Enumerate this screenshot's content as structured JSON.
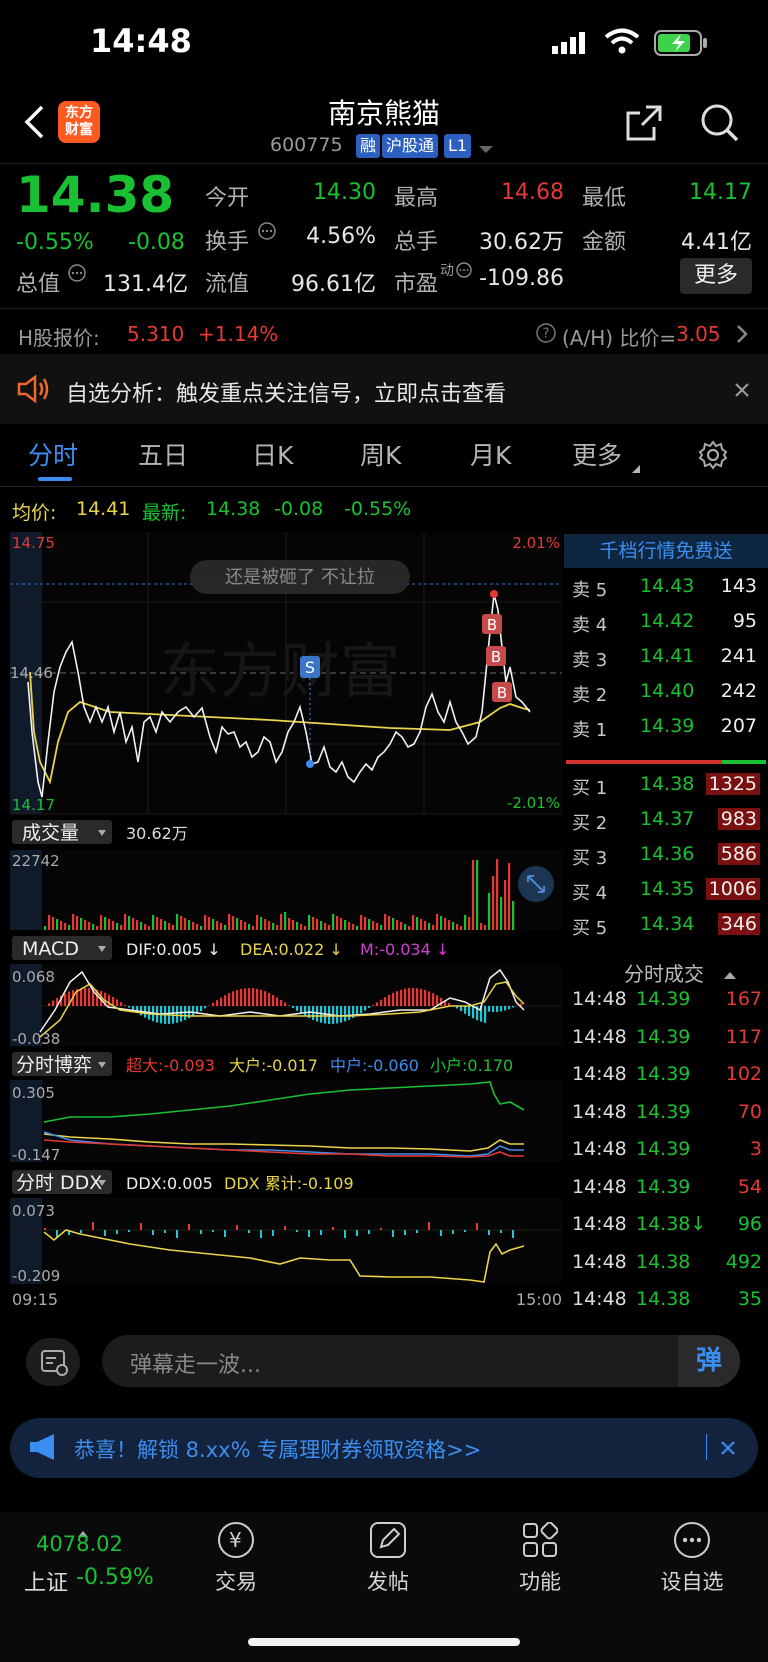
{
  "status_bar": {
    "time": "14:48"
  },
  "header": {
    "logo_text": "东方\n财富",
    "stock_name": "南京熊猫",
    "stock_code": "600775",
    "tags": [
      "融",
      "沪股通",
      "L1"
    ]
  },
  "quote": {
    "price": "14.38",
    "change_pct": "-0.55%",
    "change": "-0.08",
    "open_label": "今开",
    "open": "14.30",
    "high_label": "最高",
    "high": "14.68",
    "low_label": "最低",
    "low": "14.17",
    "turnover_label": "换手",
    "turnover": "4.56%",
    "volume_label": "总手",
    "volume": "30.62万",
    "amount_label": "金额",
    "amount": "4.41亿",
    "mktcap_label": "总值",
    "mktcap": "131.4亿",
    "float_label": "流值",
    "float": "96.61亿",
    "pe_label": "市盈",
    "pe_sup": "动",
    "pe": "-109.86",
    "more_label": "更多"
  },
  "hshare": {
    "label": "H股报价:",
    "price": "5.310",
    "change_pct": "+1.14%",
    "ah_label": "(A/H) 比价=",
    "ah_value": "3.05"
  },
  "notice": {
    "text": "自选分析：触发重点关注信号，立即点击查看"
  },
  "tabs": [
    "分时",
    "五日",
    "日K",
    "周K",
    "月K",
    "更多"
  ],
  "chart": {
    "avg_label": "均价:",
    "avg": "14.41",
    "latest_label": "最新:",
    "latest": "14.38",
    "latest_chg": "-0.08",
    "latest_pct": "-0.55%",
    "y_top": "14.75",
    "y_mid": "14.46",
    "y_bottom": "14.17",
    "pct_top": "2.01%",
    "pct_bottom": "-2.01%",
    "watermark": "东方财富",
    "bubble": "还是被砸了 不让拉",
    "volume_label": "成交量",
    "volume_value": "30.62万",
    "volume_max": "22742",
    "macd_label": "MACD",
    "dif": "DIF:0.005 ↓",
    "dea": "DEA:0.022 ↓",
    "m": "M:-0.034 ↓",
    "macd_top": "0.068",
    "macd_bottom": "-0.038",
    "game_label": "分时博弈",
    "game_super": "超大:-0.093",
    "game_big": "大户:-0.017",
    "game_mid": "中户:-0.060",
    "game_small": "小户:0.170",
    "game_top": "0.305",
    "game_bottom": "-0.147",
    "ddx_label": "分时 DDX",
    "ddx": "DDX:0.005",
    "ddx_sum": "DDX 累计:-0.109",
    "ddx_top": "0.073",
    "ddx_bottom": "-0.209",
    "time_start": "09:15",
    "time_end": "15:00"
  },
  "orderbook": {
    "promo": "千档行情免费送",
    "asks": [
      {
        "label": "卖 5",
        "price": "14.43",
        "vol": "143"
      },
      {
        "label": "卖 4",
        "price": "14.42",
        "vol": "95"
      },
      {
        "label": "卖 3",
        "price": "14.41",
        "vol": "241"
      },
      {
        "label": "卖 2",
        "price": "14.40",
        "vol": "242"
      },
      {
        "label": "卖 1",
        "price": "14.39",
        "vol": "207"
      }
    ],
    "bids": [
      {
        "label": "买 1",
        "price": "14.38",
        "vol": "1325"
      },
      {
        "label": "买 2",
        "price": "14.37",
        "vol": "983"
      },
      {
        "label": "买 3",
        "price": "14.36",
        "vol": "586"
      },
      {
        "label": "买 4",
        "price": "14.35",
        "vol": "1006"
      },
      {
        "label": "买 5",
        "price": "14.34",
        "vol": "346"
      }
    ],
    "ticks_title": "分时成交",
    "ticks": [
      {
        "time": "14:48",
        "price": "14.39",
        "vol": "167",
        "color": "red"
      },
      {
        "time": "14:48",
        "price": "14.39",
        "vol": "117",
        "color": "red"
      },
      {
        "time": "14:48",
        "price": "14.39",
        "vol": "102",
        "color": "red"
      },
      {
        "time": "14:48",
        "price": "14.39",
        "vol": "70",
        "color": "red"
      },
      {
        "time": "14:48",
        "price": "14.39",
        "vol": "3",
        "color": "red"
      },
      {
        "time": "14:48",
        "price": "14.39",
        "vol": "54",
        "color": "red"
      },
      {
        "time": "14:48",
        "price": "14.38↓",
        "vol": "96",
        "color": "green"
      },
      {
        "time": "14:48",
        "price": "14.38",
        "vol": "492",
        "color": "green"
      },
      {
        "time": "14:48",
        "price": "14.38",
        "vol": "35",
        "color": "green"
      }
    ]
  },
  "comment": {
    "placeholder": "弹幕走一波...",
    "send": "弹"
  },
  "ad": {
    "text": "恭喜！解锁 8.xx% 专属理财券领取资格>>"
  },
  "bottom_nav": {
    "index_value": "4078.02",
    "index_name": "上证",
    "index_pct": "-0.59%",
    "items": [
      "交易",
      "发帖",
      "功能",
      "设自选"
    ]
  },
  "colors": {
    "up": "#e53935",
    "down": "#19c132",
    "accent": "#3b8ef0",
    "avg_line": "#e9d44a"
  }
}
